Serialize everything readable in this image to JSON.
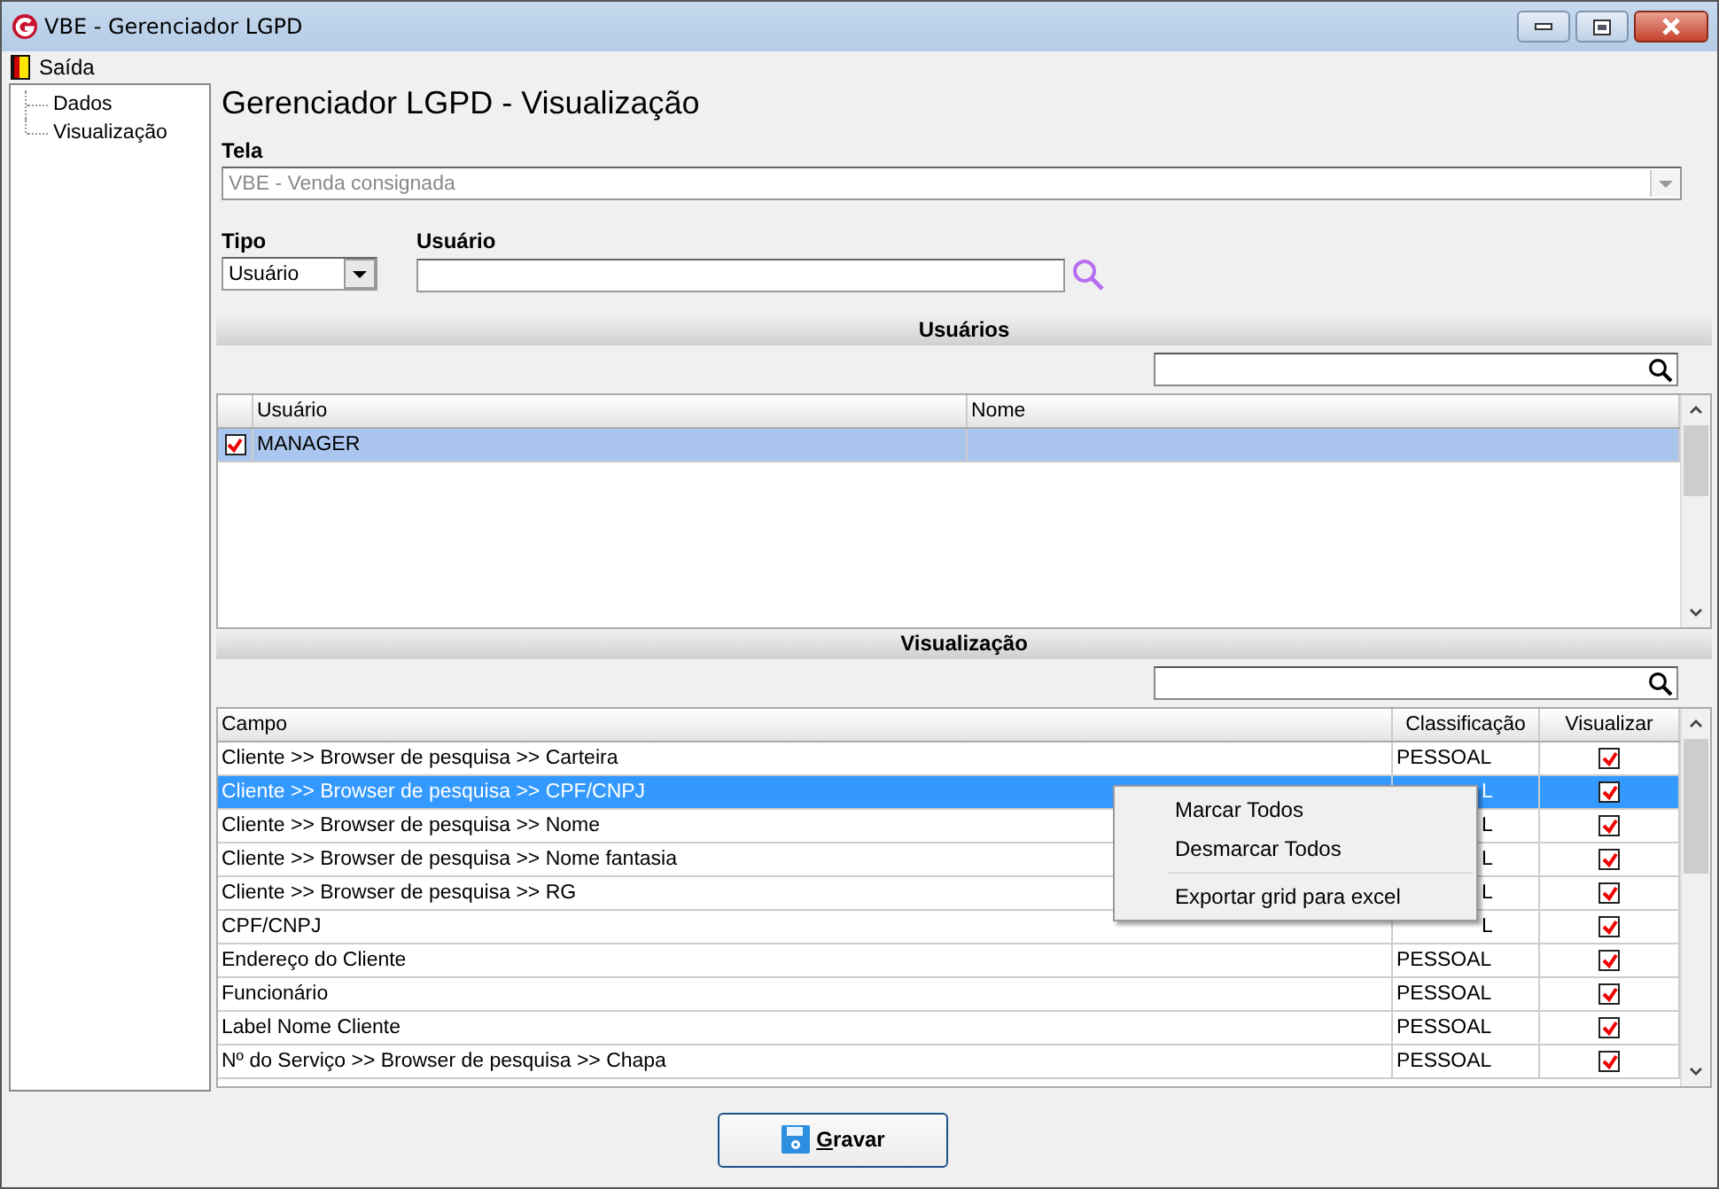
{
  "window": {
    "title": "VBE - Gerenciador LGPD"
  },
  "menu": [
    {
      "label": "Saída"
    }
  ],
  "tree": [
    {
      "label": "Dados"
    },
    {
      "label": "Visualização"
    }
  ],
  "page_title": "Gerenciador LGPD - Visualização",
  "tela": {
    "label": "Tela",
    "value": "VBE - Venda consignada",
    "disabled": true
  },
  "tipo": {
    "label": "Tipo",
    "value": "Usuário"
  },
  "usuario": {
    "label": "Usuário"
  },
  "users_section": {
    "title": "Usuários",
    "columns": [
      "Usuário",
      "Nome"
    ],
    "rows": [
      {
        "checked": true,
        "selected": true,
        "cells": [
          "MANAGER",
          ""
        ]
      }
    ]
  },
  "view_section": {
    "title": "Visualização",
    "columns": [
      "Campo",
      "Classificação",
      "Visualizar"
    ],
    "rows": [
      {
        "campo": "Cliente >> Browser de pesquisa >> Carteira",
        "classificacao": "PESSOAL",
        "visualizar": true,
        "selected": false
      },
      {
        "campo": "Cliente >> Browser de pesquisa >> CPF/CNPJ",
        "classificacao": "L",
        "covered": true,
        "visualizar": true,
        "selected": true
      },
      {
        "campo": "Cliente >> Browser de pesquisa >> Nome",
        "classificacao": "L",
        "covered": true,
        "visualizar": true,
        "selected": false
      },
      {
        "campo": "Cliente >> Browser de pesquisa >> Nome fantasia",
        "classificacao": "L",
        "covered": true,
        "visualizar": true,
        "selected": false
      },
      {
        "campo": "Cliente >> Browser de pesquisa >> RG",
        "classificacao": "L",
        "covered": true,
        "visualizar": true,
        "selected": false
      },
      {
        "campo": "CPF/CNPJ",
        "classificacao": "L",
        "covered": true,
        "visualizar": true,
        "selected": false
      },
      {
        "campo": "Endereço do Cliente",
        "classificacao": "PESSOAL",
        "visualizar": true,
        "selected": false
      },
      {
        "campo": "Funcionário",
        "classificacao": "PESSOAL",
        "visualizar": true,
        "selected": false
      },
      {
        "campo": "Label Nome Cliente",
        "classificacao": "PESSOAL",
        "visualizar": true,
        "selected": false
      },
      {
        "campo": "Nº do Serviço >> Browser de pesquisa >> Chapa",
        "classificacao": "PESSOAL",
        "visualizar": true,
        "selected": false
      }
    ]
  },
  "context_menu": {
    "groups": [
      [
        "Marcar Todos",
        "Desmarcar Todos"
      ],
      [
        "Exportar grid para excel"
      ]
    ]
  },
  "buttons": [
    {
      "label": "Gravar"
    }
  ]
}
